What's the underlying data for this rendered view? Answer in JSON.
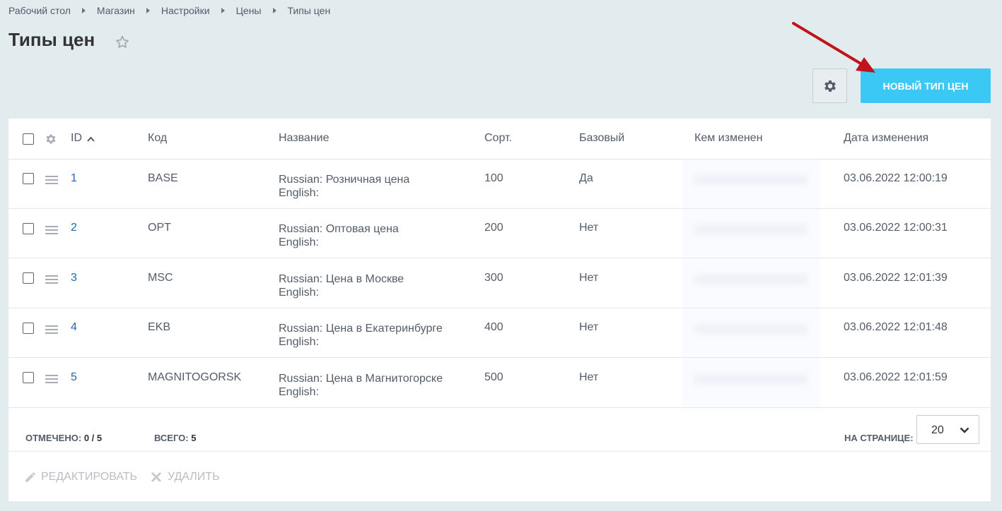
{
  "breadcrumbs": [
    "Рабочий стол",
    "Магазин",
    "Настройки",
    "Цены",
    "Типы цен"
  ],
  "page_title": "Типы цен",
  "new_button_label": "Новый тип цен",
  "columns": {
    "id": "ID",
    "code": "Код",
    "name": "Название",
    "sort": "Сорт.",
    "base": "Базовый",
    "modified_by": "Кем изменен",
    "modified_date": "Дата изменения"
  },
  "rows": [
    {
      "id": "1",
      "code": "BASE",
      "name_ru": "Russian: Розничная цена",
      "name_en": "English:",
      "sort": "100",
      "base": "Да",
      "date": "03.06.2022 12:00:19"
    },
    {
      "id": "2",
      "code": "OPT",
      "name_ru": "Russian: Оптовая цена",
      "name_en": "English:",
      "sort": "200",
      "base": "Нет",
      "date": "03.06.2022 12:00:31"
    },
    {
      "id": "3",
      "code": "MSC",
      "name_ru": "Russian: Цена в Москве",
      "name_en": "English:",
      "sort": "300",
      "base": "Нет",
      "date": "03.06.2022 12:01:39"
    },
    {
      "id": "4",
      "code": "EKB",
      "name_ru": "Russian: Цена в Екатеринбурге",
      "name_en": "English:",
      "sort": "400",
      "base": "Нет",
      "date": "03.06.2022 12:01:48"
    },
    {
      "id": "5",
      "code": "MAGNITOGORSK",
      "name_ru": "Russian: Цена в Магнитогорске",
      "name_en": "English:",
      "sort": "500",
      "base": "Нет",
      "date": "03.06.2022 12:01:59"
    }
  ],
  "footer": {
    "selected_label": "Отмечено:",
    "selected_value": "0 / 5",
    "total_label": "Всего:",
    "total_value": "5",
    "per_page_label": "На странице:",
    "per_page_value": "20"
  },
  "actions": {
    "edit": "Редактировать",
    "delete": "Удалить"
  },
  "colors": {
    "accent": "#3bc8f5",
    "link": "#2067b0",
    "annotation_arrow": "#c0141a",
    "background": "#e2ebee"
  }
}
